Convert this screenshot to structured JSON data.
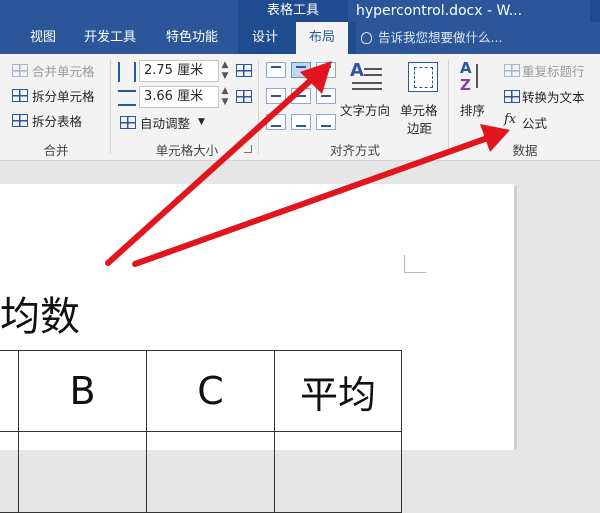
{
  "titlebar": {
    "context_title": "表格工具",
    "doc_title": "hypercontrol.docx - W..."
  },
  "tabs": {
    "view": "视图",
    "developer": "开发工具",
    "special": "特色功能",
    "design": "设计",
    "layout": "布局",
    "tell_me": "告诉我您想要做什么..."
  },
  "ribbon": {
    "merge": {
      "merge_cells": "合并单元格",
      "split_cells": "拆分单元格",
      "split_table": "拆分表格",
      "label": "合并"
    },
    "cell_size": {
      "height_value": "2.75 厘米",
      "width_value": "3.66 厘米",
      "autofit": "自动调整",
      "label": "单元格大小"
    },
    "alignment": {
      "text_direction": "文字方向",
      "cell_margins_line1": "单元格",
      "cell_margins_line2": "边距",
      "label": "对齐方式"
    },
    "data": {
      "sort": "排序",
      "repeat_header": "重复标题行",
      "convert_text": "转换为文本",
      "formula": "公式",
      "label": "数据"
    }
  },
  "document": {
    "heading_fragment": "均数",
    "table_headers": [
      "",
      "B",
      "C",
      "平均"
    ]
  },
  "colors": {
    "accent": "#2b579a",
    "accent_dark": "#1f4b8f",
    "arrow": "#e0151d"
  }
}
